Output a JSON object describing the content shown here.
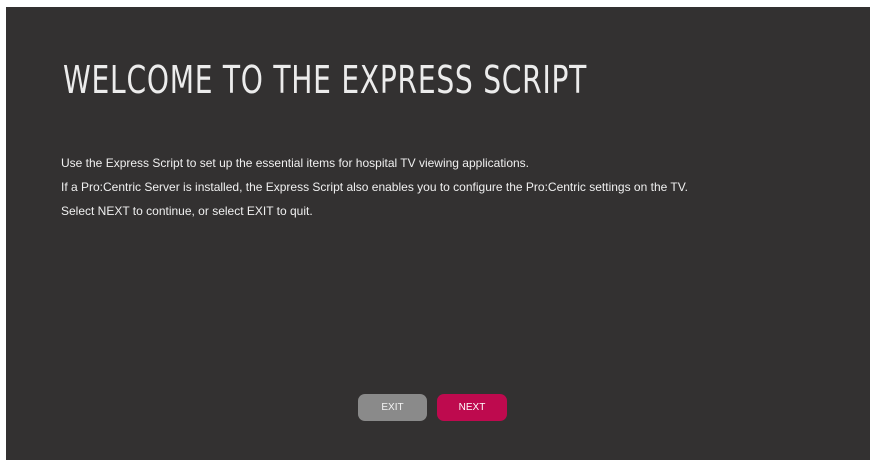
{
  "screen": {
    "title": "WELCOME TO THE EXPRESS SCRIPT",
    "paragraphs": [
      "Use the Express Script to set up the essential items for hospital TV viewing applications.",
      "If a Pro:Centric Server is installed, the Express Script also enables you to configure the Pro:Centric settings on the TV.",
      "Select NEXT to continue, or select EXIT to quit."
    ]
  },
  "buttons": {
    "exit_label": "EXIT",
    "next_label": "NEXT"
  },
  "colors": {
    "background": "#333131",
    "accent": "#be0a4e",
    "exit_button": "#8a8a8a"
  }
}
